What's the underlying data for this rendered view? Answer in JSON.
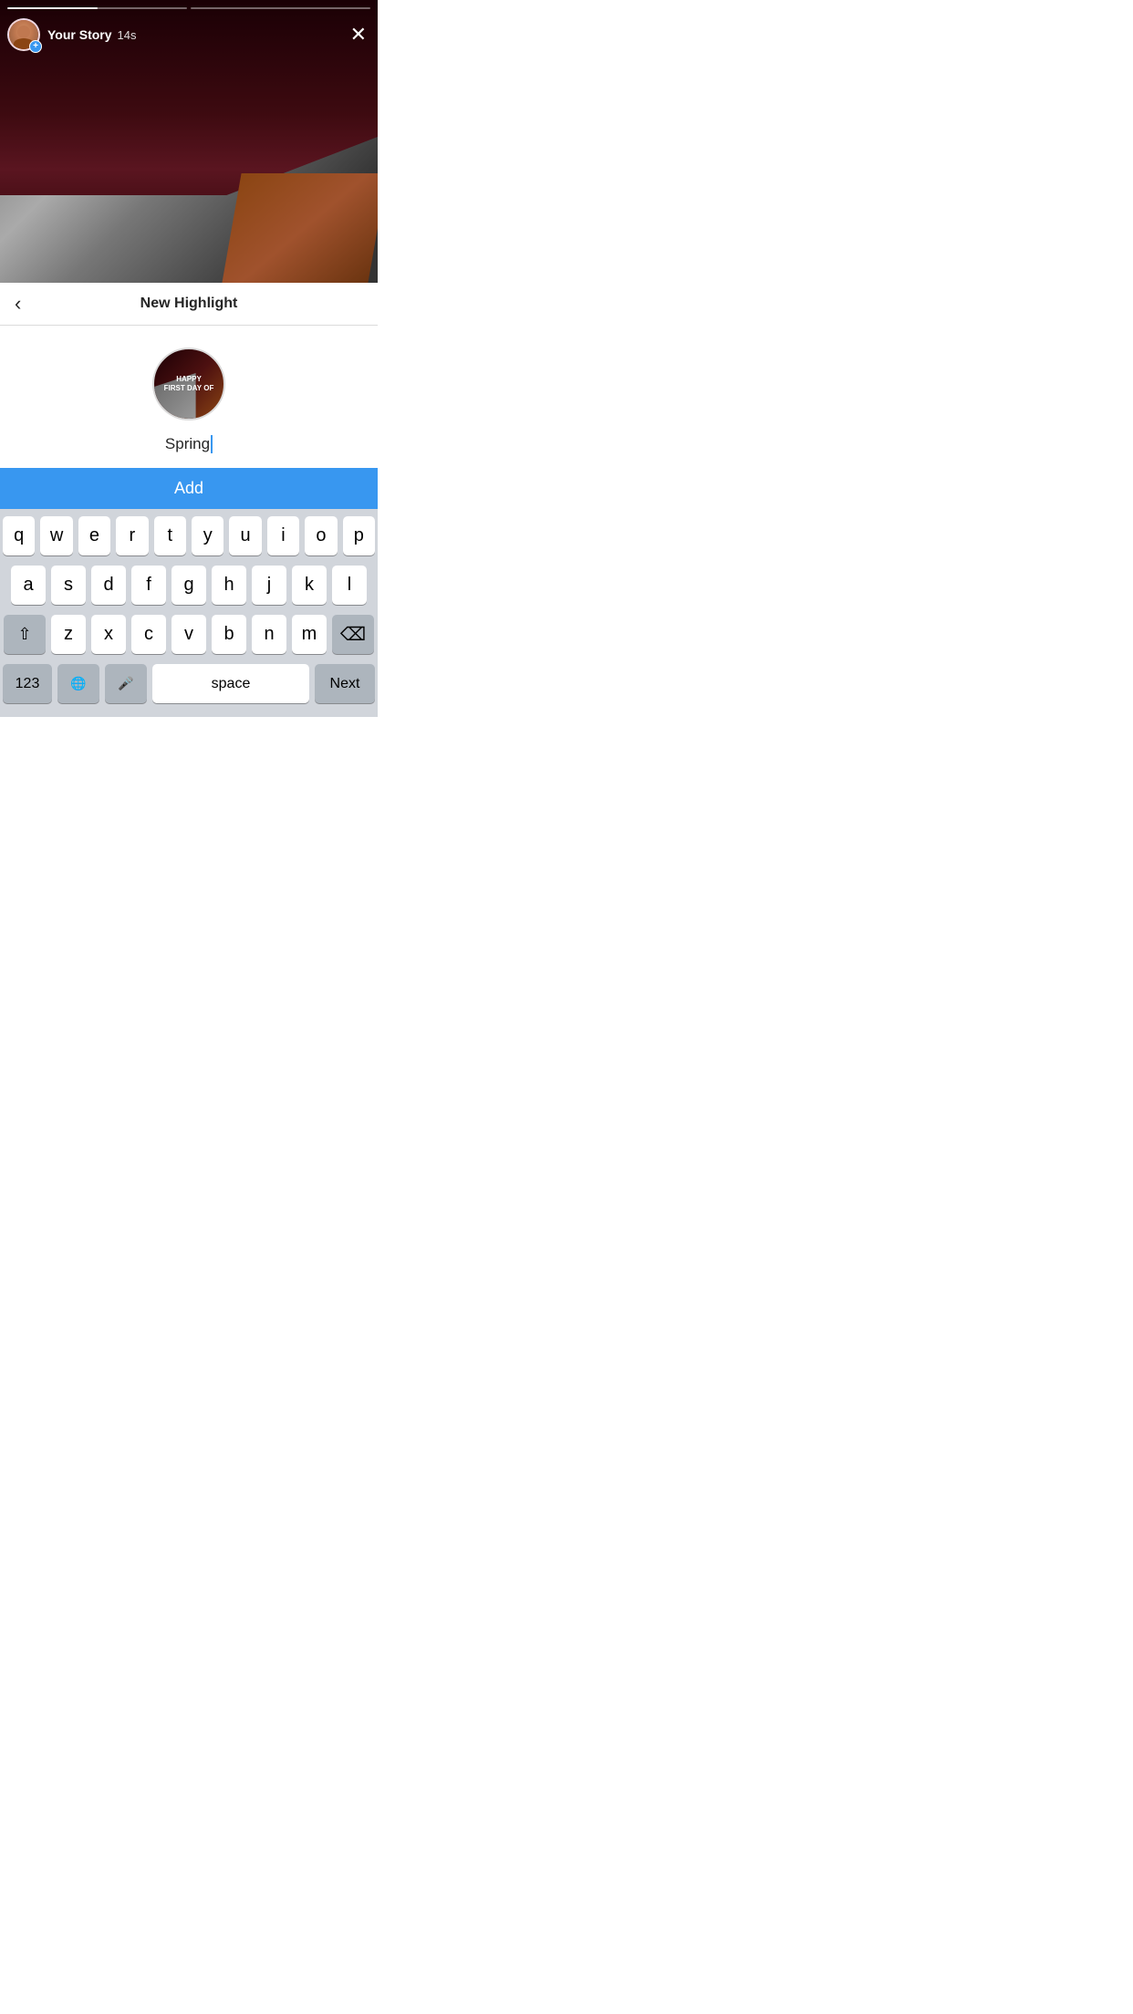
{
  "story": {
    "user_label": "Your Story",
    "duration": "14s",
    "add_badge": "+",
    "close_symbol": "✕"
  },
  "progress": {
    "bar1_fill": "50",
    "bar2_fill": "0"
  },
  "highlight": {
    "title": "New Highlight",
    "back_symbol": "‹",
    "cover_text_line1": "HAPPY",
    "cover_text_line2": "FIRST DAY OF",
    "input_value": "Spring",
    "add_label": "Add"
  },
  "keyboard": {
    "rows": [
      [
        "q",
        "w",
        "e",
        "r",
        "t",
        "y",
        "u",
        "i",
        "o",
        "p"
      ],
      [
        "a",
        "s",
        "d",
        "f",
        "g",
        "h",
        "j",
        "k",
        "l"
      ],
      [
        "z",
        "x",
        "c",
        "v",
        "b",
        "n",
        "m"
      ]
    ],
    "num_label": "123",
    "globe_symbol": "🌐",
    "mic_symbol": "🎤",
    "space_label": "space",
    "next_label": "Next",
    "delete_symbol": "⌫",
    "shift_symbol": "⇧"
  }
}
